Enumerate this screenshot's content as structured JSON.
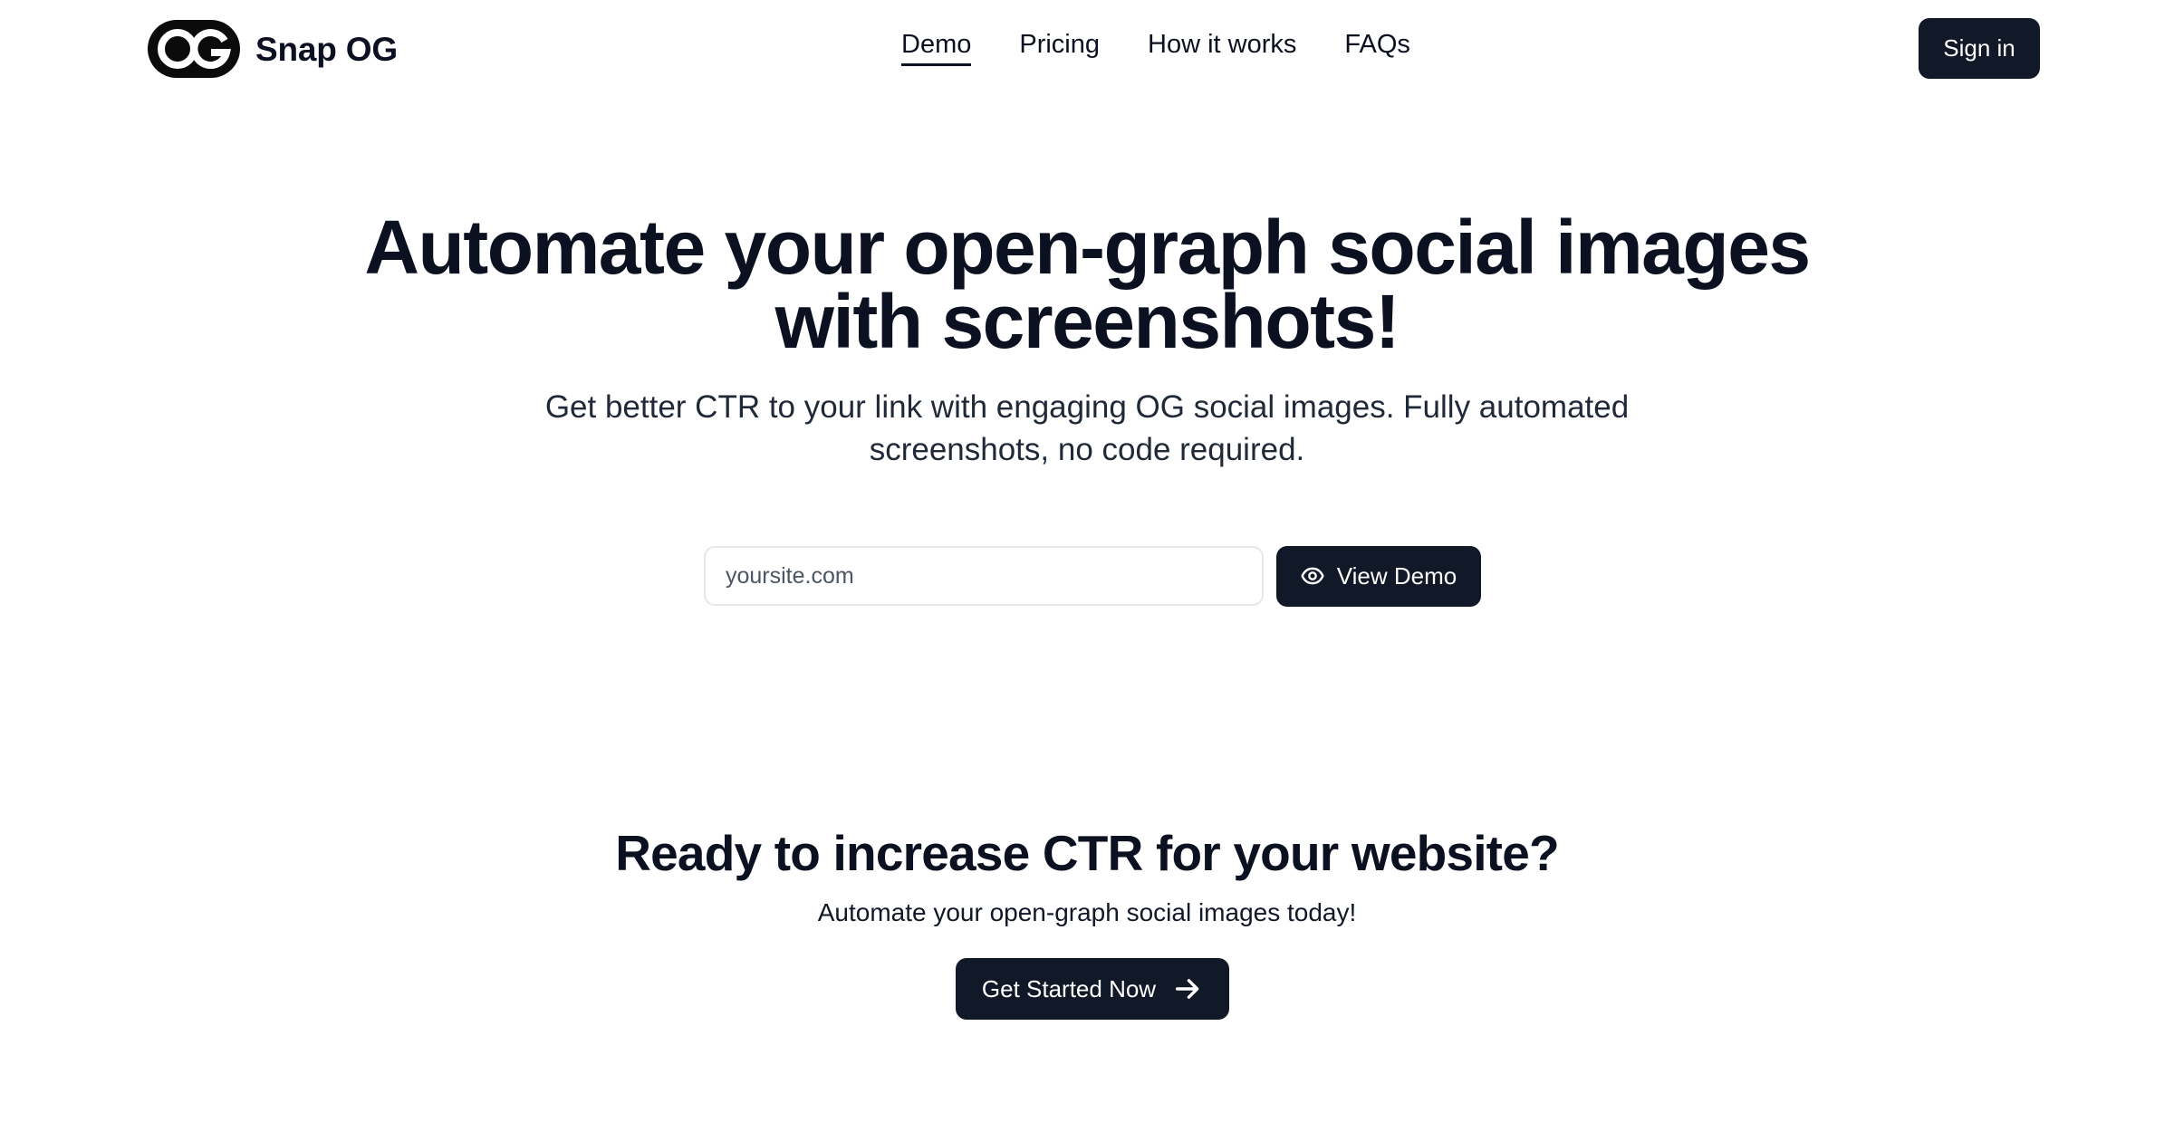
{
  "header": {
    "brand_name": "Snap OG",
    "logo_icon": "og-logo-icon",
    "nav": [
      {
        "label": "Demo",
        "active": true
      },
      {
        "label": "Pricing",
        "active": false
      },
      {
        "label": "How it works",
        "active": false
      },
      {
        "label": "FAQs",
        "active": false
      }
    ],
    "signin_label": "Sign in"
  },
  "hero": {
    "title_line1": "Automate your open-graph social images",
    "title_line2": "with screenshots!",
    "subtitle_line1": "Get better CTR to your link with engaging OG social images. Fully automated",
    "subtitle_line2": "screenshots, no code required.",
    "input_placeholder": "yoursite.com",
    "input_value": "",
    "demo_button_label": "View Demo",
    "demo_button_icon": "eye-icon"
  },
  "cta": {
    "title": "Ready to increase CTR for your website?",
    "subtitle": "Automate your open-graph social images today!",
    "button_label": "Get Started Now",
    "button_icon": "arrow-right-icon"
  },
  "colors": {
    "primary": "#111827",
    "text": "#0b1120",
    "input_border": "#e5e7eb",
    "background": "#ffffff"
  }
}
